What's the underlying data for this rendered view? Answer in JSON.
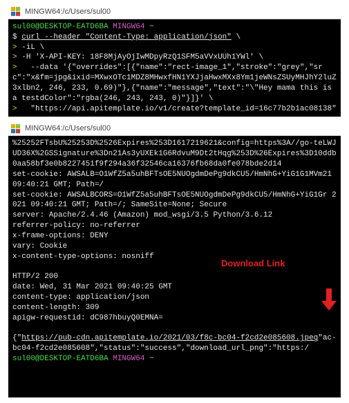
{
  "window1": {
    "title": "MINGW64:/c/Users/sul00",
    "prompt_user": "sul00@DESKTOP-EATD6BA",
    "prompt_env": "MINGW64",
    "prompt_path": "~",
    "dollar": "$",
    "cmd_part1": "curl --header \"Content-Type: application/json\"",
    "cmd_cont": "\\",
    "line_il": "-iL \\",
    "line_h": "-H 'X-API-KEY: 18F8MjAyOjIwMDpyRzQ1SFM5aVVxUUh1YWl' \\",
    "line_data": "   --data '{\"overrides\":[{\"name\":\"rect-image_1\",\"stroke\":\"grey\",\"src\":\"x&fm=jpg&ixid=MXwxOTc1MDZ8MHwxfHN1YXJjaHwxMXx8Ym1jeWNsZSUyMHJhY2luZ3xlbn2, 246, 233, 0.69)\"},{\"name\":\"message\",\"text\":\"\\\"Hey mama this is a testdColor\":\"rgba(246, 243, 243, 0)\"}]}' \\",
    "line_url": "   \"https://api.apitemplate.io/v1/create?template_id=16c77b2b1ac08138\""
  },
  "window2": {
    "title": "MINGW64:/c/Users/sul00",
    "resp1": "%25252FTsbU%25253D%2526Expires%253D1617219621&config=https%3A//go-teLWJUD36X%2GSSignature%3Dn21As3yUXEk1G6RdvuM9Dt2tHqg%253D%26Expires%3D10ddb0aa58bf3e0b8227451f9f294a36f32546ca16376fb68da0fe078bde2d14",
    "resp2": "set-cookie: AWSALB=O1WfZ5a5uhBFTsOE5NUOgdmDePg9dkCU5/HmNhG+YiG1G1MVm21 09:40:21 GMT; Path=/",
    "resp3": "set-cookie: AWSALBCORS=O1WfZ5a5uhBFTsOE5NUOgdmDePg9dkCU5/HmNhG+YiG1Gr 2021 09:40:21 GMT; Path=/; SameSite=None; Secure",
    "resp4": "server: Apache/2.4.46 (Amazon) mod_wsgi/3.5 Python/3.6.12",
    "resp5": "referrer-policy: no-referrer",
    "resp6": "x-frame-options: DENY",
    "resp7": "vary: Cookie",
    "resp8": "x-content-type-options: nosniff",
    "http_status": "HTTP/2 200",
    "date": "date: Wed, 31 Mar 2021 09:40:25 GMT",
    "ctype": "content-type: application/json",
    "clen": "content-length: 309",
    "apigw": "apigw-requestid: dC987hbuyQ0EMNA=",
    "json_pre": "{\"",
    "json_link": "https://pub-cdn.apitemplate.io/2021/03/f8c-bc04-f2cd2e085608.jpeg",
    "json_post": "\"ac-bc04-f2cd2e085608\",\"status\":\"success\",\"download_url_png\":\"https:/",
    "download_label": "Download Link",
    "prompt_user": "sul00@DESKTOP-EATD6BA",
    "prompt_env": "MINGW64",
    "prompt_path": "~"
  }
}
